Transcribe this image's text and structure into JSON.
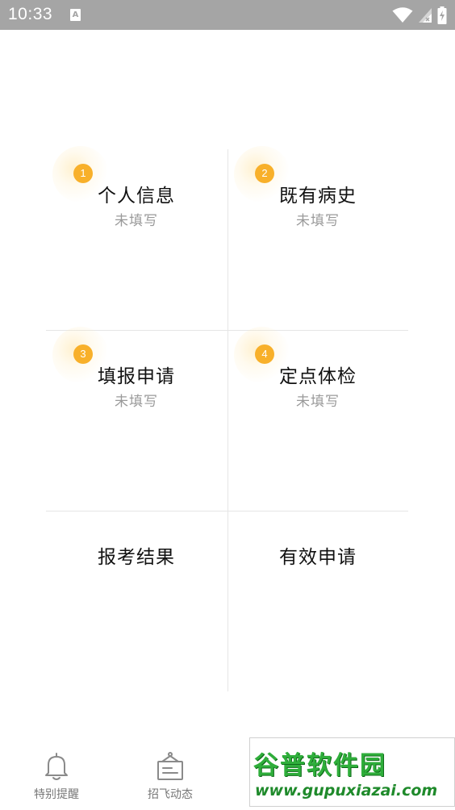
{
  "status_bar": {
    "time": "10:33",
    "notification_icon_letter": "A",
    "icons": [
      "wifi-icon",
      "signal-icon",
      "battery-charging-icon"
    ],
    "background": "#a5a5a5"
  },
  "grid": {
    "items": [
      {
        "badge": "1",
        "title": "个人信息",
        "status": "未填写"
      },
      {
        "badge": "2",
        "title": "既有病史",
        "status": "未填写"
      },
      {
        "badge": "3",
        "title": "填报申请",
        "status": "未填写"
      },
      {
        "badge": "4",
        "title": "定点体检",
        "status": "未填写"
      },
      {
        "title": "报考结果"
      },
      {
        "title": "有效申请"
      }
    ]
  },
  "bottom_nav": {
    "items": [
      {
        "label": "特别提醒",
        "icon": "bell-icon"
      },
      {
        "label": "招飞动态",
        "icon": "signboard-icon"
      }
    ]
  },
  "watermark": {
    "main": "谷普软件园",
    "url": "www.gupuxiazai.com"
  },
  "colors": {
    "badge": "#f8b02a",
    "status_text": "#9a9a9a",
    "divider": "#e6e6e6",
    "watermark_green": "#2fae3b"
  }
}
